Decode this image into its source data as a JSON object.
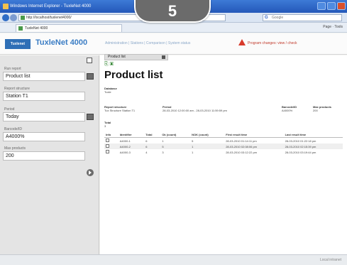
{
  "step_badge": "5",
  "window": {
    "title": "Windows Internet Explorer - TuxleNet 4000"
  },
  "address_bar": {
    "url": "http://localhost/tuxlenet4000/",
    "search_placeholder": "Google"
  },
  "browser_tab": {
    "label": "TuxleNet 4000",
    "tools_text": "Page · Tools"
  },
  "app_header": {
    "logo_text": "Tuxlenet",
    "product_name": "TuxleNet 4000",
    "nav_links": "Administration | Stations | Comparison | System status",
    "warning_text": "Program changes: view / check"
  },
  "content_tab": {
    "label": "Product list"
  },
  "sidebar": {
    "fields": [
      {
        "label": "Run report",
        "value": "Product list"
      },
      {
        "label": "Report structure",
        "value": "Station T1"
      },
      {
        "label": "Period",
        "value": "Today"
      },
      {
        "label": "Barcode/ID",
        "value": "A4000%"
      },
      {
        "label": "Max products",
        "value": "200"
      }
    ]
  },
  "report": {
    "title": "Product list",
    "database_label": "Database",
    "database_value": "Tuxle",
    "structure_label": "Report structure",
    "structure_value": "Tux Structure Station T1",
    "period_label": "Period",
    "period_value": "28-03-2010 12:00:00 am - 28-03-2010 11:59:59 pm",
    "barcode_label": "Barcode/ID",
    "barcode_value": "A4000%",
    "max_label": "Max products",
    "max_value": "200",
    "total_label": "Total",
    "total_value": "3"
  },
  "table": {
    "columns": [
      "Info",
      "Identifier",
      "Total",
      "Ok (count)",
      "NOK (count)",
      "First result time",
      "Last result time"
    ],
    "rows": [
      [
        "",
        "A4000-1",
        "6",
        "1",
        "5",
        "28-03-2010 01:14:11 pm",
        "28-03-2010 01:22:18 pm"
      ],
      [
        "",
        "A4000-2",
        "6",
        "5",
        "1",
        "28-03-2010 02:08:06 pm",
        "28-03-2010 02:15:39 pm"
      ],
      [
        "",
        "A4000-3",
        "4",
        "3",
        "1",
        "28-03-2010 03:12:22 pm",
        "28-03-2010 03:19:44 pm"
      ]
    ]
  },
  "status_bar": {
    "zone": "Local intranet"
  },
  "colors": {
    "accent": "#3b7dc4",
    "warning": "#d83a2b",
    "badge": "#6b6b6b"
  }
}
